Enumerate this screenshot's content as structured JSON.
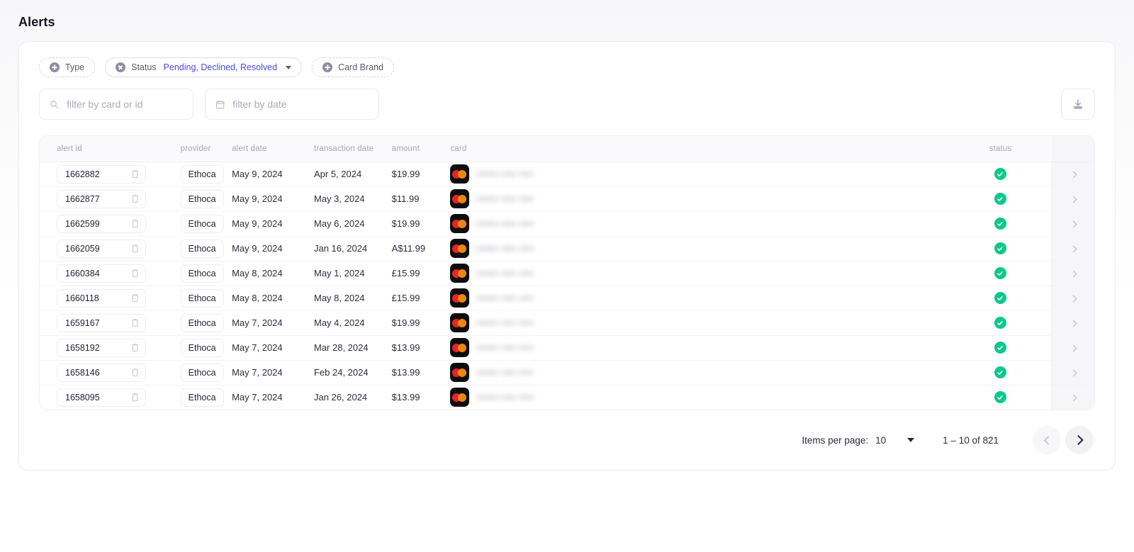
{
  "page": {
    "title": "Alerts"
  },
  "filters": {
    "chips": [
      {
        "label": "Type",
        "icon": "plus-circle-icon",
        "style": "dashed",
        "values": "",
        "caret": false
      },
      {
        "label": "Status",
        "icon": "remove-circle-icon",
        "style": "solid",
        "values": "Pending, Declined, Resolved",
        "caret": true
      },
      {
        "label": "Card Brand",
        "icon": "plus-circle-icon",
        "style": "dashed",
        "values": "",
        "caret": false
      }
    ],
    "search": {
      "placeholder": "filter by card or id",
      "value": "",
      "icon": "search-icon"
    },
    "date": {
      "placeholder": "filter by date",
      "value": "",
      "icon": "calendar-icon"
    },
    "download": {
      "icon": "download-icon",
      "label": "Download"
    }
  },
  "table": {
    "columns": [
      "alert id",
      "provider",
      "alert date",
      "transaction date",
      "amount",
      "card",
      "status"
    ],
    "rows": [
      {
        "alert_id": "1662882",
        "provider": "Ethoca",
        "alert_date": "May 9, 2024",
        "transaction_date": "Apr 5, 2024",
        "amount": "$19.99",
        "card_brand": "mastercard",
        "status": "resolved"
      },
      {
        "alert_id": "1662877",
        "provider": "Ethoca",
        "alert_date": "May 9, 2024",
        "transaction_date": "May 3, 2024",
        "amount": "$11.99",
        "card_brand": "mastercard",
        "status": "resolved"
      },
      {
        "alert_id": "1662599",
        "provider": "Ethoca",
        "alert_date": "May 9, 2024",
        "transaction_date": "May 6, 2024",
        "amount": "$19.99",
        "card_brand": "mastercard",
        "status": "resolved"
      },
      {
        "alert_id": "1662059",
        "provider": "Ethoca",
        "alert_date": "May 9, 2024",
        "transaction_date": "Jan 16, 2024",
        "amount": "A$11.99",
        "card_brand": "mastercard",
        "status": "resolved"
      },
      {
        "alert_id": "1660384",
        "provider": "Ethoca",
        "alert_date": "May 8, 2024",
        "transaction_date": "May 1, 2024",
        "amount": "£15.99",
        "card_brand": "mastercard",
        "status": "resolved"
      },
      {
        "alert_id": "1660118",
        "provider": "Ethoca",
        "alert_date": "May 8, 2024",
        "transaction_date": "May 8, 2024",
        "amount": "£15.99",
        "card_brand": "mastercard",
        "status": "resolved"
      },
      {
        "alert_id": "1659167",
        "provider": "Ethoca",
        "alert_date": "May 7, 2024",
        "transaction_date": "May 4, 2024",
        "amount": "$19.99",
        "card_brand": "mastercard",
        "status": "resolved"
      },
      {
        "alert_id": "1658192",
        "provider": "Ethoca",
        "alert_date": "May 7, 2024",
        "transaction_date": "Mar 28, 2024",
        "amount": "$13.99",
        "card_brand": "mastercard",
        "status": "resolved"
      },
      {
        "alert_id": "1658146",
        "provider": "Ethoca",
        "alert_date": "May 7, 2024",
        "transaction_date": "Feb 24, 2024",
        "amount": "$13.99",
        "card_brand": "mastercard",
        "status": "resolved"
      },
      {
        "alert_id": "1658095",
        "provider": "Ethoca",
        "alert_date": "May 7, 2024",
        "transaction_date": "Jan 26, 2024",
        "amount": "$13.99",
        "card_brand": "mastercard",
        "status": "resolved"
      }
    ],
    "masked_card": "•••••• •••• ••••",
    "copy_icon": "copy-icon",
    "row_expand_icon": "chevron-right-icon",
    "status_icon": "check-circle-icon"
  },
  "pagination": {
    "items_per_page_label": "Items per page:",
    "items_per_page_value": "10",
    "range": "1 – 10 of 821",
    "prev_icon": "chevron-left-icon",
    "next_icon": "chevron-right-icon",
    "prev_enabled": false,
    "next_enabled": true
  },
  "colors": {
    "accent_link": "#4a4ae8",
    "status_resolved": "#0bc98a",
    "panel_border": "#ededf1",
    "mastercard_red": "#eb2228",
    "mastercard_orange": "#f79410"
  }
}
